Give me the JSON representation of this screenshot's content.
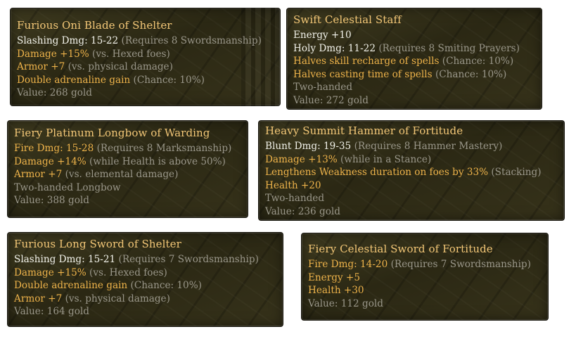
{
  "tooltips": [
    {
      "title": "Furious Oni Blade of Shelter",
      "lines": [
        {
          "main": "Slashing Dmg: 15-22",
          "note": "(Requires 8 Swordsmanship)"
        },
        {
          "main": "Damage +15%",
          "note": "(vs. Hexed foes)"
        },
        {
          "main": "Armor +7",
          "note": "(vs. physical damage)"
        },
        {
          "main": "Double adrenaline gain",
          "note": "(Chance: 10%)"
        },
        {
          "main": "Value: 268 gold",
          "note": ""
        }
      ]
    },
    {
      "title": "Swift Celestial Staff",
      "lines": [
        {
          "main": "Energy +10",
          "note": ""
        },
        {
          "main": "Holy Dmg: 11-22",
          "note": "(Requires 8 Smiting Prayers)"
        },
        {
          "main": "Halves skill recharge of spells",
          "note": "(Chance: 10%)"
        },
        {
          "main": "Halves casting time of spells",
          "note": "(Chance: 10%)"
        },
        {
          "main": "Two-handed",
          "note": ""
        },
        {
          "main": "Value: 272 gold",
          "note": ""
        }
      ]
    },
    {
      "title": "Fiery Platinum Longbow of Warding",
      "lines": [
        {
          "main": "Fire Dmg: 15-28",
          "note": "(Requires 8 Marksmanship)"
        },
        {
          "main": "Damage +14%",
          "note": "(while Health is above 50%)"
        },
        {
          "main": "Armor +7",
          "note": "(vs. elemental damage)"
        },
        {
          "main": "Two-handed Longbow",
          "note": ""
        },
        {
          "main": "Value: 388 gold",
          "note": ""
        }
      ]
    },
    {
      "title": "Heavy Summit Hammer of Fortitude",
      "lines": [
        {
          "main": "Blunt Dmg: 19-35",
          "note": "(Requires 8 Hammer Mastery)"
        },
        {
          "main": "Damage +13%",
          "note": "(while in a Stance)"
        },
        {
          "main": "Lengthens Weakness duration on foes by 33%",
          "note": "(Stacking)"
        },
        {
          "main": "Health +20",
          "note": ""
        },
        {
          "main": "Two-handed",
          "note": ""
        },
        {
          "main": "Value: 236 gold",
          "note": ""
        }
      ]
    },
    {
      "title": "Furious Long Sword of Shelter",
      "lines": [
        {
          "main": "Slashing Dmg: 15-21",
          "note": "(Requires 7 Swordsmanship)"
        },
        {
          "main": "Damage +15%",
          "note": "(vs. Hexed foes)"
        },
        {
          "main": "Double adrenaline gain",
          "note": "(Chance: 10%)"
        },
        {
          "main": "Armor +7",
          "note": "(vs. physical damage)"
        },
        {
          "main": "Value: 164 gold",
          "note": ""
        }
      ]
    },
    {
      "title": "Fiery Celestial Sword of Fortitude",
      "lines": [
        {
          "main": "Fire Dmg: 14-20",
          "note": "(Requires 7 Swordsmanship)"
        },
        {
          "main": "Energy +5",
          "note": ""
        },
        {
          "main": "Health +30",
          "note": ""
        },
        {
          "main": "Value: 112 gold",
          "note": ""
        }
      ]
    }
  ],
  "colors": {
    "title": "#f3c777",
    "base_stat": "#f2f2ea",
    "modifier": "#eeb34a",
    "note": "#9a978a"
  }
}
